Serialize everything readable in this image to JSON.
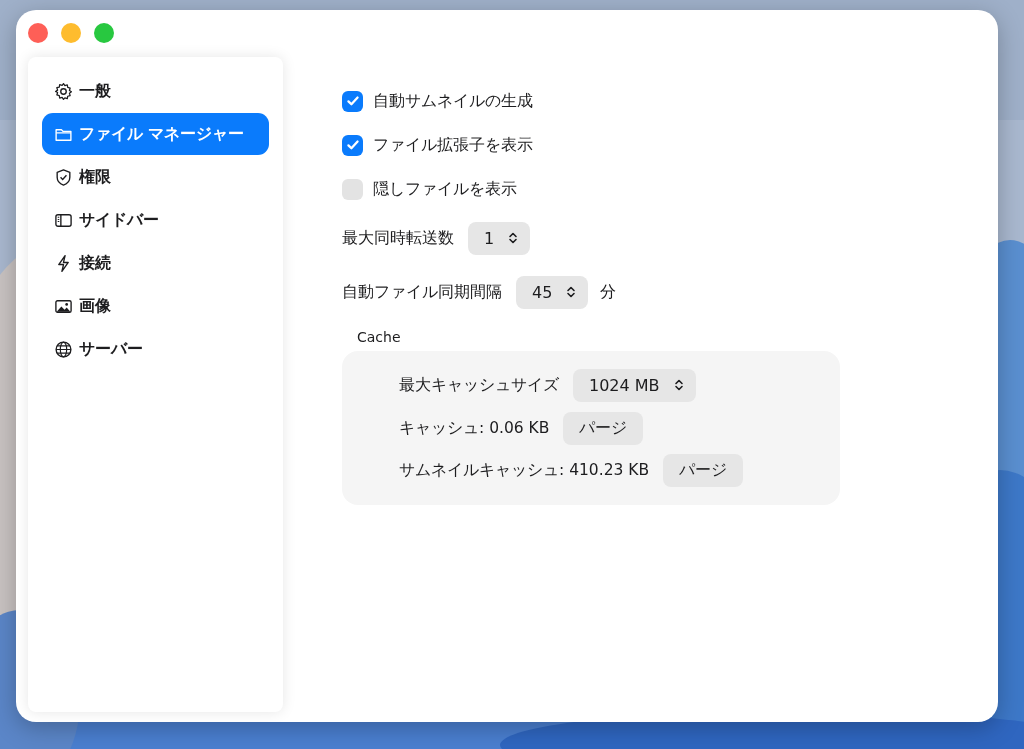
{
  "sidebar": {
    "items": [
      {
        "label": "一般",
        "selected": false
      },
      {
        "label": "ファイル マネージャー",
        "selected": true
      },
      {
        "label": "権限",
        "selected": false
      },
      {
        "label": "サイドバー",
        "selected": false
      },
      {
        "label": "接続",
        "selected": false
      },
      {
        "label": "画像",
        "selected": false
      },
      {
        "label": "サーバー",
        "selected": false
      }
    ]
  },
  "settings": [
    {
      "kind": "checkbox",
      "label": "自動サムネイルの生成",
      "checked": true
    },
    {
      "kind": "checkbox",
      "label": "ファイル拡張子を表示",
      "checked": true
    },
    {
      "kind": "checkbox",
      "label": "隠しファイルを表示",
      "checked": false
    },
    {
      "kind": "stepper",
      "label": "最大同時転送数",
      "value": "1"
    },
    {
      "kind": "stepper",
      "label": "自動ファイル同期間隔",
      "value": "45",
      "unit": "分"
    }
  ],
  "cache": {
    "title": "Cache",
    "rows": [
      {
        "kind": "stepper",
        "label": "最大キャッシュサイズ",
        "value": "1024 MB"
      },
      {
        "kind": "purge",
        "label": "キャッシュ: 0.06 KB",
        "button": "パージ"
      },
      {
        "kind": "purge",
        "label": "サムネイルキャッシュ: 410.23 KB",
        "button": "パージ"
      }
    ]
  }
}
